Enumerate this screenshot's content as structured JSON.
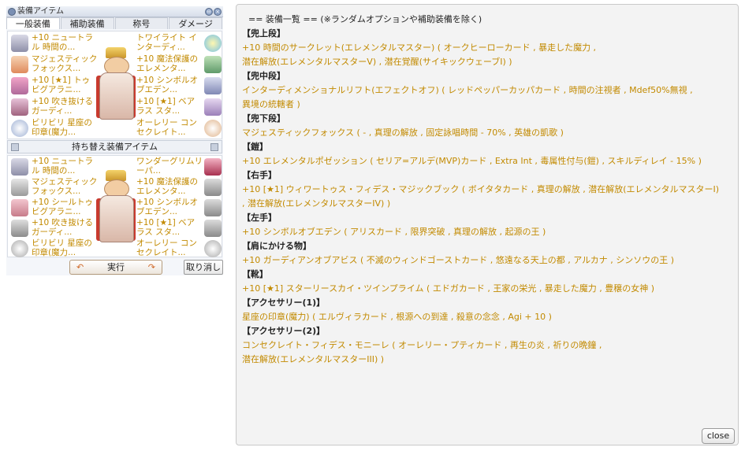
{
  "window": {
    "title": "装備アイテム",
    "minimize_glyph": "⊖",
    "close_glyph": "×",
    "tabs": [
      {
        "label": "一般装備",
        "active": true
      },
      {
        "label": "補助装備",
        "active": false
      },
      {
        "label": "称号",
        "active": false
      },
      {
        "label": "ダメージ",
        "active": false
      }
    ]
  },
  "equipped": {
    "left": [
      {
        "text": "+10 ニュートラル 時間の...",
        "icon": "circlet-icon"
      },
      {
        "text": "マジェスティックフォックス...",
        "icon": "fox-hat-icon"
      },
      {
        "text": "+10 [★1] トゥビグアラニ...",
        "icon": "book-icon"
      },
      {
        "text": "+10 吹き抜けるガーディ...",
        "icon": "manteau-icon"
      },
      {
        "text": "ビリビリ 星座の印章(魔力...",
        "icon": "seal-icon"
      }
    ],
    "right": [
      {
        "text": "トワイライト インターディ...",
        "icon": "lower-headgear-icon"
      },
      {
        "text": "+10 魔法保護のエレメンタ...",
        "icon": "armor-icon"
      },
      {
        "text": "+10 シンボルオブエデン...",
        "icon": "shield-icon"
      },
      {
        "text": "+10 [★1] ベアラス スタ...",
        "icon": "shoes-icon"
      },
      {
        "text": "オーレリー コンセクレイト...",
        "icon": "accessory-icon"
      }
    ]
  },
  "swap": {
    "header": "持ち替え装備アイテム",
    "left": [
      {
        "text": "+10 ニュートラル 時間の...",
        "icon": "circlet-icon"
      },
      {
        "text": "マジェスティックフォックス...",
        "icon": "fox-hat-icon"
      },
      {
        "text": "+10 シールトゥビグアラニ...",
        "icon": "wand-icon"
      },
      {
        "text": "+10 吹き抜けるガーディ...",
        "icon": "manteau-icon"
      },
      {
        "text": "ビリビリ 星座の印章(魔力...",
        "icon": "seal-icon"
      }
    ],
    "right": [
      {
        "text": "ワンダーグリムリーパ...",
        "icon": "wings-icon"
      },
      {
        "text": "+10 魔法保護のエレメンタ...",
        "icon": "armor-icon"
      },
      {
        "text": "+10 シンボルオブエデン...",
        "icon": "shield-icon"
      },
      {
        "text": "+10 [★1] ベアラス スタ...",
        "icon": "shoes-icon"
      },
      {
        "text": "オーレリー コンセクレイト...",
        "icon": "accessory-icon"
      }
    ]
  },
  "buttons": {
    "execute": "実行",
    "cancel": "取り消し",
    "close": "close"
  },
  "colors": {
    "item_text": "#c28a00",
    "heading_text": "#222222"
  },
  "info": {
    "title": "== 装備一覧 == (※ランダムオプションや補助装備を除く)",
    "lines": [
      {
        "type": "head",
        "text": "【兜上段】"
      },
      {
        "type": "item",
        "text": "+10 時間のサークレット(エレメンタルマスター) ( オークヒーローカード , 暴走した魔力 ,"
      },
      {
        "type": "item",
        "text": "潜在解放(エレメンタルマスターV) , 潜在覚醒(サイキックウェーブI) )"
      },
      {
        "type": "head",
        "text": "【兜中段】"
      },
      {
        "type": "item",
        "text": "インターディメンショナルリフト(エフェクトオフ) ( レッドペッパーカッパカード , 時間の注視者 , Mdef50%無視 ,"
      },
      {
        "type": "item",
        "text": "異境の統轄者 )"
      },
      {
        "type": "head",
        "text": "【兜下段】"
      },
      {
        "type": "item",
        "text": "マジェスティックフォックス ( - , 真理の解放 , 固定詠唱時間 - 70% , 英雄の凱歌 )"
      },
      {
        "type": "head",
        "text": "【鎧】"
      },
      {
        "type": "item",
        "text": "+10 エレメンタルポゼッション ( セリア=アルデ(MVP)カード , Extra Int , 毒属性付与(鎧) , スキルディレイ - 15% )"
      },
      {
        "type": "head",
        "text": "【右手】"
      },
      {
        "type": "item",
        "text": "+10 [★1] ウィワートゥス・フィデス・マジックブック ( ボイタタカード , 真理の解放 , 潜在解放(エレメンタルマスターI)"
      },
      {
        "type": "item",
        "text": ", 潜在解放(エレメンタルマスターIV) )"
      },
      {
        "type": "head",
        "text": "【左手】"
      },
      {
        "type": "item",
        "text": "+10 シンボルオブエデン ( アリスカード , 限界突破 , 真理の解放 , 起源の王 )"
      },
      {
        "type": "head",
        "text": "【肩にかける物】"
      },
      {
        "type": "item",
        "text": "+10 ガーディアンオブアビス ( 不滅のウィンドゴーストカード , 悠遠なる天上の都 , アルカナ , シンソウの王 )"
      },
      {
        "type": "head",
        "text": "【靴】"
      },
      {
        "type": "item",
        "text": "+10 [★1] スターリースカイ・ツインプライム ( エドガカード , 王家の栄光 , 暴走した魔力 , 豊穣の女神 )"
      },
      {
        "type": "head",
        "text": "【アクセサリー(1)】"
      },
      {
        "type": "item",
        "text": "星座の印章(魔力) ( エルヴィラカード , 根源への到達 , 殺意の念念 , Agi + 10 )"
      },
      {
        "type": "head",
        "text": "【アクセサリー(2)】"
      },
      {
        "type": "item",
        "text": "コンセクレイト・フィデス・モニーレ ( オーレリー・プティカード , 再生の炎 , 祈りの晩鐘 ,"
      },
      {
        "type": "item",
        "text": "潜在解放(エレメンタルマスターIII) )"
      }
    ]
  }
}
